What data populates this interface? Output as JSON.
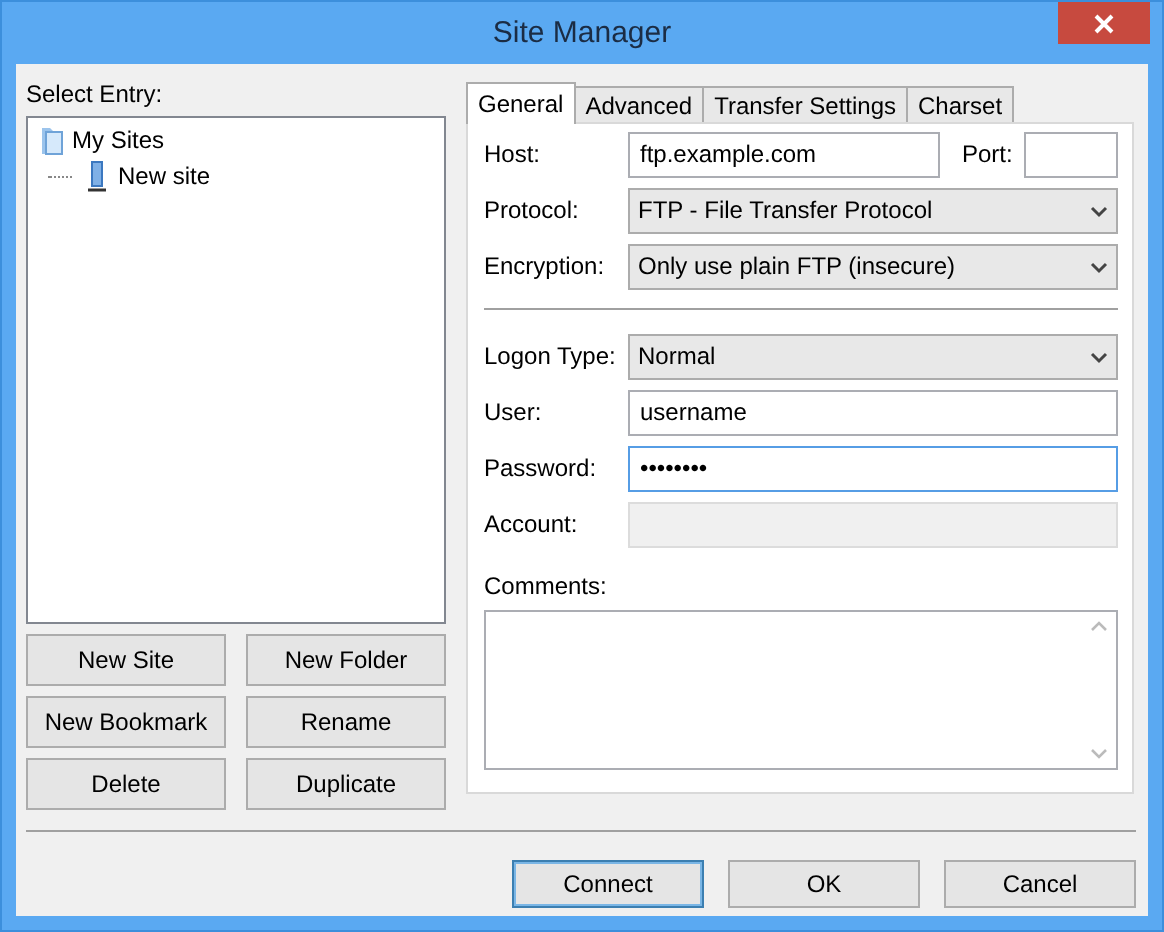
{
  "window": {
    "title": "Site Manager"
  },
  "select_entry": {
    "label": "Select Entry:",
    "tree": [
      {
        "label": "My Sites",
        "kind": "folder",
        "children": [
          {
            "label": "New site",
            "kind": "site"
          }
        ]
      }
    ]
  },
  "entry_buttons": [
    {
      "label": "New Site"
    },
    {
      "label": "New Folder"
    },
    {
      "label": "New Bookmark"
    },
    {
      "label": "Rename"
    },
    {
      "label": "Delete"
    },
    {
      "label": "Duplicate"
    }
  ],
  "tabs": [
    {
      "label": "General",
      "selected": true
    },
    {
      "label": "Advanced",
      "selected": false
    },
    {
      "label": "Transfer Settings",
      "selected": false
    },
    {
      "label": "Charset",
      "selected": false
    }
  ],
  "general": {
    "host": {
      "label": "Host:",
      "value": "ftp.example.com"
    },
    "port": {
      "label": "Port:"
    },
    "protocol": {
      "label": "Protocol:",
      "value": "FTP - File Transfer Protocol"
    },
    "encryption": {
      "label": "Encryption:",
      "value": "Only use plain FTP (insecure)"
    },
    "logon_type": {
      "label": "Logon Type:",
      "value": "Normal"
    },
    "user": {
      "label": "User:",
      "value": "username",
      "focused": false
    },
    "password": {
      "label": "Password:",
      "value": "••••••••",
      "focused": true
    },
    "account": {
      "label": "Account:",
      "disabled": true
    },
    "comments": {
      "label": "Comments:"
    }
  },
  "footer_buttons": [
    {
      "label": "Connect",
      "default": true
    },
    {
      "label": "OK",
      "default": false
    },
    {
      "label": "Cancel",
      "default": false
    }
  ]
}
